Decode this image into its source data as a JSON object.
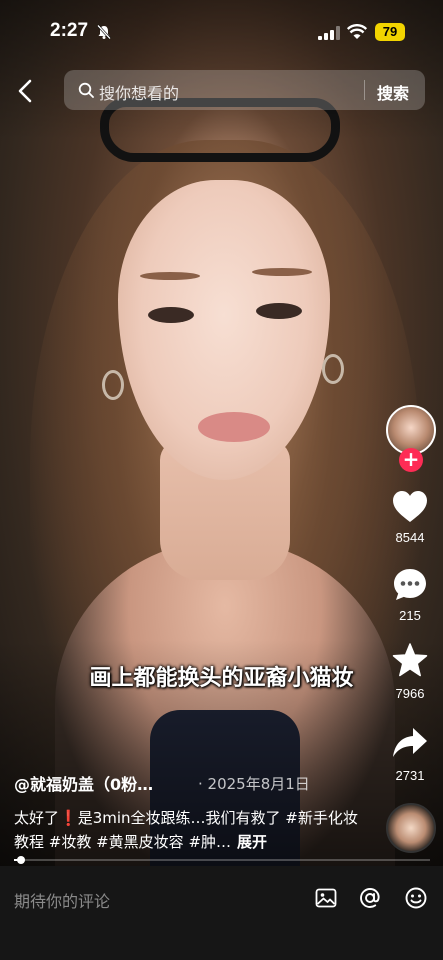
{
  "status_bar": {
    "time": "2:27",
    "battery": "79"
  },
  "search": {
    "placeholder": "搜你想看的",
    "button_label": "搜索"
  },
  "video": {
    "caption_overlay": "画上都能换头的亚裔小猫妆"
  },
  "actions": {
    "likes": "8544",
    "comments": "215",
    "favorites": "7966",
    "shares": "2731"
  },
  "post": {
    "author": "@就福奶盖（0粉…",
    "date": "2025年8月1日",
    "description_part1": "太好了",
    "description_part2": "是3min全妆跟练…我们有救了 #新手化妆教程 #妆教 #黄黑皮妆容 #肿…",
    "expand_label": "展开",
    "progress": 0.01
  },
  "comment_bar": {
    "placeholder": "期待你的评论"
  },
  "colors": {
    "follow_accent": "#fe2c55",
    "battery": "#f2d400",
    "comment_bar_bg": "#161616"
  },
  "icons": {
    "back": "chevron-left-icon",
    "search": "search-icon",
    "like": "heart-icon",
    "comment": "comment-bubble-icon",
    "favorite": "star-icon",
    "share": "share-arrow-icon",
    "image": "image-icon",
    "mention": "at-sign-icon",
    "emoji": "emoji-icon",
    "follow": "plus-icon"
  }
}
